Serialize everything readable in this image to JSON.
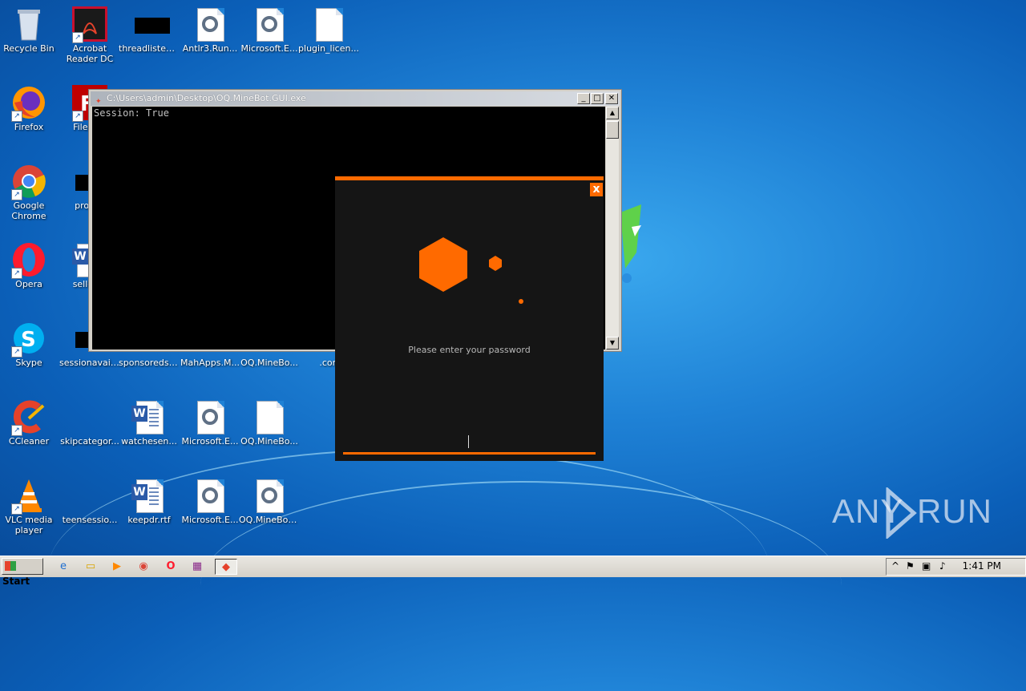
{
  "desktop_icons": [
    {
      "id": "recycle-bin",
      "label": "Recycle Bin"
    },
    {
      "id": "acrobat",
      "label": "Acrobat Reader DC"
    },
    {
      "id": "threadlisten",
      "label": "threadlisten..."
    },
    {
      "id": "antlr3",
      "label": "Antlr3.Run..."
    },
    {
      "id": "microsoft-e1",
      "label": "Microsoft.E..."
    },
    {
      "id": "plugin-licen",
      "label": "plugin_licen..."
    },
    {
      "id": "firefox",
      "label": "Firefox"
    },
    {
      "id": "filezilla",
      "label": "FileZilla"
    },
    {
      "id": "google-chrome",
      "label": "Google Chrome"
    },
    {
      "id": "proced",
      "label": "proced"
    },
    {
      "id": "opera",
      "label": "Opera"
    },
    {
      "id": "sellersu",
      "label": "sellersu"
    },
    {
      "id": "skype",
      "label": "Skype"
    },
    {
      "id": "sessionavail",
      "label": "sessionavail..."
    },
    {
      "id": "sponsoredst",
      "label": "sponsoredst..."
    },
    {
      "id": "mahapps",
      "label": "MahApps.M..."
    },
    {
      "id": "oq-minebo-1",
      "label": "OQ.MineBo..."
    },
    {
      "id": "con",
      "label": ".con"
    },
    {
      "id": "ccleaner",
      "label": "CCleaner"
    },
    {
      "id": "skipcategor",
      "label": "skipcategor..."
    },
    {
      "id": "watchesen",
      "label": "watchesen..."
    },
    {
      "id": "microsoft-e2",
      "label": "Microsoft.E..."
    },
    {
      "id": "oq-minebo-2",
      "label": "OQ.MineBo..."
    },
    {
      "id": "vlc",
      "label": "VLC media player"
    },
    {
      "id": "teensession",
      "label": "teensessio..."
    },
    {
      "id": "keepdr",
      "label": "keepdr.rtf"
    },
    {
      "id": "microsoft-e3",
      "label": "Microsoft.E..."
    },
    {
      "id": "oq-minebot-3",
      "label": "OQ.MineBot..."
    }
  ],
  "console": {
    "title": "C:\\Users\\admin\\Desktop\\OQ.MineBot.GUI.exe",
    "output": "Session: True",
    "minimize": "_",
    "maximize": "□",
    "close": "✕"
  },
  "dialog": {
    "prompt": "Please enter your password",
    "close_label": "x",
    "accent": "#ff6a00"
  },
  "watermark": {
    "left": "ANY",
    "right": "RUN"
  },
  "taskbar": {
    "start_label": "Start",
    "clock": "1:41 PM",
    "tray_expand": "^"
  },
  "colors": {
    "accent": "#ff6a00",
    "console_bg": "#000000",
    "dialog_bg": "#151515"
  }
}
